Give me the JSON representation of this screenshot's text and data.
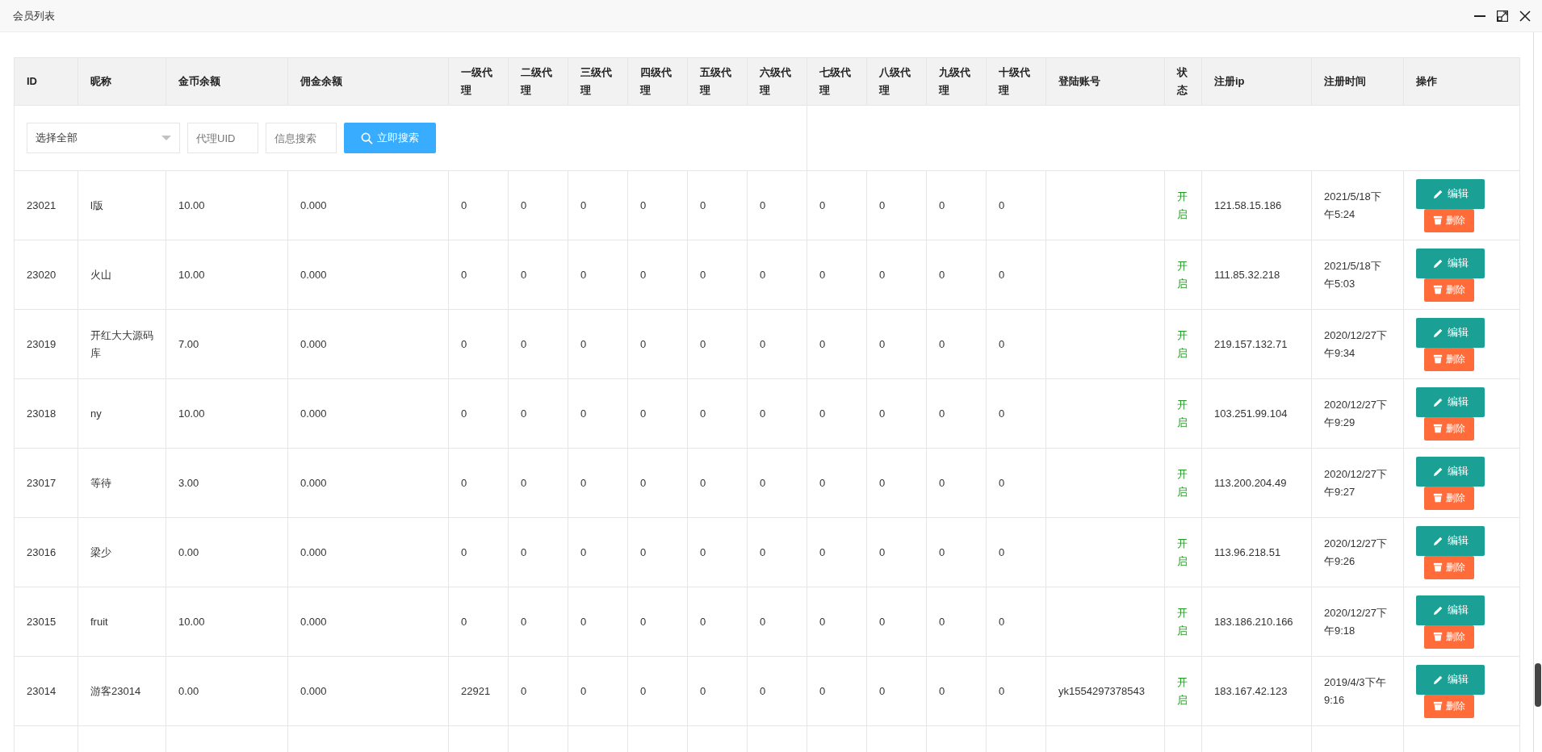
{
  "window": {
    "title": "会员列表"
  },
  "table": {
    "columns": [
      "ID",
      "昵称",
      "金币余额",
      "佣金余额",
      "一级代理",
      "二级代理",
      "三级代理",
      "四级代理",
      "五级代理",
      "六级代理",
      "七级代理",
      "八级代理",
      "九级代理",
      "十级代理",
      "登陆账号",
      "状态",
      "注册ip",
      "注册时间",
      "操作"
    ],
    "filter": {
      "select_value": "选择全部",
      "uid_placeholder": "代理UID",
      "search_placeholder": "信息搜索",
      "search_button": "立即搜索"
    },
    "rows": [
      {
        "id": "23021",
        "nickname": "l版",
        "coins": "10.00",
        "commission": "0.000",
        "agents": [
          "0",
          "0",
          "0",
          "0",
          "0",
          "0",
          "0",
          "0",
          "0",
          "0"
        ],
        "account": "",
        "status": "开启",
        "ip": "121.58.15.186",
        "time": "2021/5/18下午5:24",
        "actions": [
          "编辑",
          "删除"
        ]
      },
      {
        "id": "23020",
        "nickname": "火山",
        "coins": "10.00",
        "commission": "0.000",
        "agents": [
          "0",
          "0",
          "0",
          "0",
          "0",
          "0",
          "0",
          "0",
          "0",
          "0"
        ],
        "account": "",
        "status": "开启",
        "ip": "111.85.32.218",
        "time": "2021/5/18下午5:03",
        "actions": [
          "编辑",
          "删除"
        ]
      },
      {
        "id": "23019",
        "nickname": "开红大大源码库",
        "coins": "7.00",
        "commission": "0.000",
        "agents": [
          "0",
          "0",
          "0",
          "0",
          "0",
          "0",
          "0",
          "0",
          "0",
          "0"
        ],
        "account": "",
        "status": "开启",
        "ip": "219.157.132.71",
        "time": "2020/12/27下午9:34",
        "actions": [
          "编辑",
          "删除"
        ]
      },
      {
        "id": "23018",
        "nickname": "ny",
        "coins": "10.00",
        "commission": "0.000",
        "agents": [
          "0",
          "0",
          "0",
          "0",
          "0",
          "0",
          "0",
          "0",
          "0",
          "0"
        ],
        "account": "",
        "status": "开启",
        "ip": "103.251.99.104",
        "time": "2020/12/27下午9:29",
        "actions": [
          "编辑",
          "删除"
        ]
      },
      {
        "id": "23017",
        "nickname": "等待",
        "coins": "3.00",
        "commission": "0.000",
        "agents": [
          "0",
          "0",
          "0",
          "0",
          "0",
          "0",
          "0",
          "0",
          "0",
          "0"
        ],
        "account": "",
        "status": "开启",
        "ip": "113.200.204.49",
        "time": "2020/12/27下午9:27",
        "actions": [
          "编辑",
          "删除"
        ]
      },
      {
        "id": "23016",
        "nickname": "梁少",
        "coins": "0.00",
        "commission": "0.000",
        "agents": [
          "0",
          "0",
          "0",
          "0",
          "0",
          "0",
          "0",
          "0",
          "0",
          "0"
        ],
        "account": "",
        "status": "开启",
        "ip": "113.96.218.51",
        "time": "2020/12/27下午9:26",
        "actions": [
          "编辑",
          "删除"
        ]
      },
      {
        "id": "23015",
        "nickname": "fruit",
        "coins": "10.00",
        "commission": "0.000",
        "agents": [
          "0",
          "0",
          "0",
          "0",
          "0",
          "0",
          "0",
          "0",
          "0",
          "0"
        ],
        "account": "",
        "status": "开启",
        "ip": "183.186.210.166",
        "time": "2020/12/27下午9:18",
        "actions": [
          "编辑",
          "删除"
        ]
      },
      {
        "id": "23014",
        "nickname": "游客23014",
        "coins": "0.00",
        "commission": "0.000",
        "agents": [
          "22921",
          "0",
          "0",
          "0",
          "0",
          "0",
          "0",
          "0",
          "0",
          "0"
        ],
        "account": "yk1554297378543",
        "status": "开启",
        "ip": "183.167.42.123",
        "time": "2019/4/3下午9:16",
        "actions": [
          "编辑",
          "删除"
        ]
      }
    ]
  }
}
